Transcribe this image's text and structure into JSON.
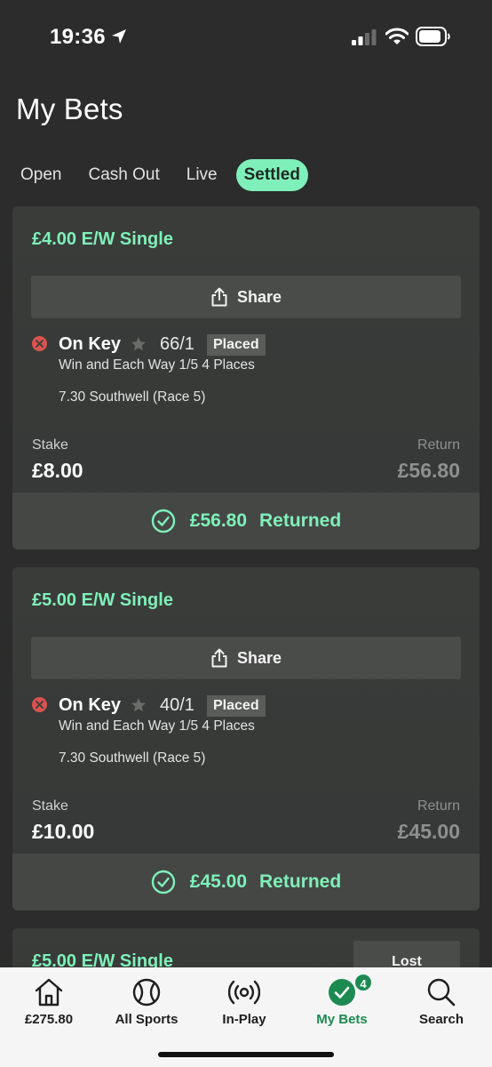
{
  "status_bar": {
    "time": "19:36"
  },
  "page_title": "My Bets",
  "tabs": [
    {
      "label": "Open"
    },
    {
      "label": "Cash Out"
    },
    {
      "label": "Live"
    },
    {
      "label": "Settled",
      "active": true
    }
  ],
  "bets": [
    {
      "title": "£4.00 E/W Single",
      "share_label": "Share",
      "selection": "On Key",
      "odds": "66/1",
      "result_badge": "Placed",
      "terms": "Win and Each Way 1/5 4 Places",
      "event": "7.30 Southwell (Race 5)",
      "stake_label": "Stake",
      "stake": "£8.00",
      "return_label": "Return",
      "return": "£56.80",
      "returned_amount": "£56.80",
      "returned_label": "Returned"
    },
    {
      "title": "£5.00 E/W Single",
      "share_label": "Share",
      "selection": "On Key",
      "odds": "40/1",
      "result_badge": "Placed",
      "terms": "Win and Each Way 1/5 4 Places",
      "event": "7.30 Southwell (Race 5)",
      "stake_label": "Stake",
      "stake": "£10.00",
      "return_label": "Return",
      "return": "£45.00",
      "returned_amount": "£45.00",
      "returned_label": "Returned"
    },
    {
      "title": "£5.00 E/W Single",
      "status_button": "Lost"
    }
  ],
  "bottom_nav": {
    "items": [
      {
        "label": "£275.80",
        "icon": "home-icon"
      },
      {
        "label": "All Sports",
        "icon": "ball-icon"
      },
      {
        "label": "In-Play",
        "icon": "broadcast-icon"
      },
      {
        "label": "My Bets",
        "icon": "check-icon",
        "active": true,
        "badge": "4"
      },
      {
        "label": "Search",
        "icon": "search-icon"
      }
    ]
  },
  "colors": {
    "accent": "#7ff0b9",
    "background": "#2b2c2b",
    "card": "#3a3c3a",
    "lost_red": "#d9534f",
    "nav_active": "#1d8a52"
  }
}
